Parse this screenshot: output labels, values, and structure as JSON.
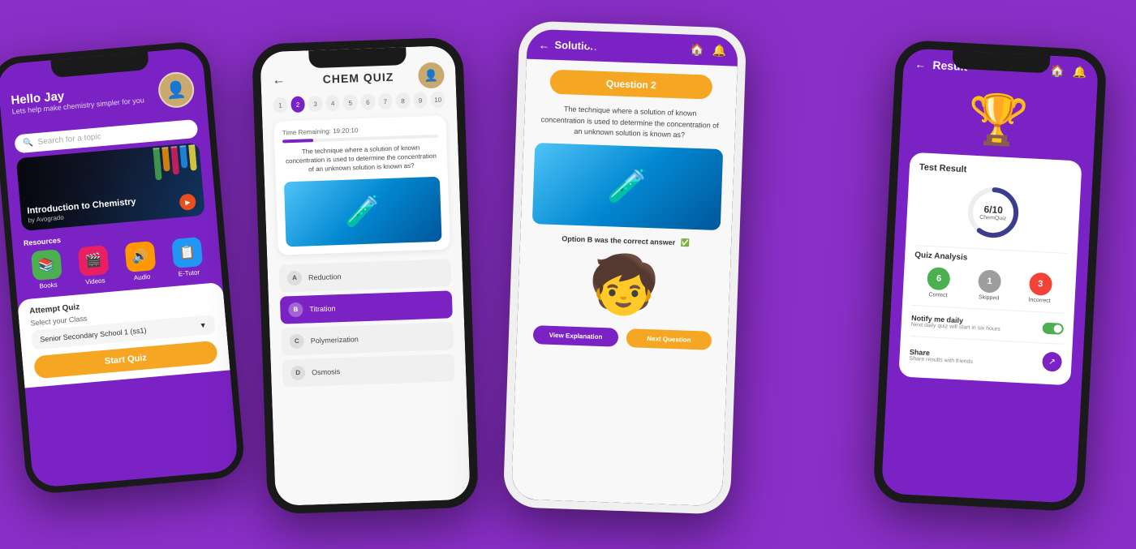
{
  "background": "#8B2FC9",
  "phone1": {
    "header": {
      "greeting": "Hello Jay",
      "subtitle": "Lets help make chemistry simpler for you"
    },
    "search": {
      "placeholder": "Search for a topic"
    },
    "video": {
      "title": "Introduction to Chemistry",
      "author": "by Avogrado"
    },
    "resources_label": "Resources",
    "resources": [
      {
        "icon": "📚",
        "label": "Books",
        "color": "#4CAF50"
      },
      {
        "icon": "🎬",
        "label": "Videos",
        "color": "#E91E63"
      },
      {
        "icon": "🔊",
        "label": "Audio",
        "color": "#FF9800"
      },
      {
        "icon": "📋",
        "label": "E-Tutor",
        "color": "#2196F3"
      }
    ],
    "attempt_quiz": "Attempt Quiz",
    "select_class": "Select your Class",
    "class_value": "Senior Secondary School 1 (ss1)",
    "start_button": "Start Quiz"
  },
  "phone2": {
    "title": "CHEM QUIZ",
    "back": "←",
    "pagination": [
      "1",
      "2",
      "3",
      "4",
      "5",
      "6",
      "7",
      "8",
      "9",
      "10"
    ],
    "active_page": 2,
    "timer": "Time Remaining: 19:20:10",
    "question_text": "The technique where a solution of known concentration is used to determine the concentration of an unknown solution is known as?",
    "options": [
      {
        "letter": "A",
        "text": "Reduction",
        "selected": false
      },
      {
        "letter": "B",
        "text": "Titration",
        "selected": true
      },
      {
        "letter": "C",
        "text": "Polymerization",
        "selected": false
      },
      {
        "letter": "D",
        "text": "Osmosis",
        "selected": false
      }
    ]
  },
  "phone3": {
    "back": "←",
    "title": "Solution",
    "question_badge": "Question 2",
    "question_text": "The technique where a solution of known concentration is used to determine the concentration of an unknown solution is known as?",
    "correct_answer": "Option B was the correct answer",
    "btn_explain": "View Explanation",
    "btn_next": "Next Question"
  },
  "phone4": {
    "back": "←",
    "title": "Result",
    "test_result_title": "Test Result",
    "score": "6/10",
    "score_sub": "ChemQuiz",
    "quiz_analysis": "Quiz Analysis",
    "correct": {
      "count": "6",
      "label": "Correct",
      "color": "#4CAF50"
    },
    "skipped": {
      "count": "1",
      "label": "Skipped",
      "color": "#9E9E9E"
    },
    "incorrect": {
      "count": "3",
      "label": "Incorrect",
      "color": "#F44336"
    },
    "notify_title": "Notify me daily",
    "notify_sub": "Next daily quiz will start in six hours",
    "share_title": "Share",
    "share_sub": "Share results with friends"
  }
}
